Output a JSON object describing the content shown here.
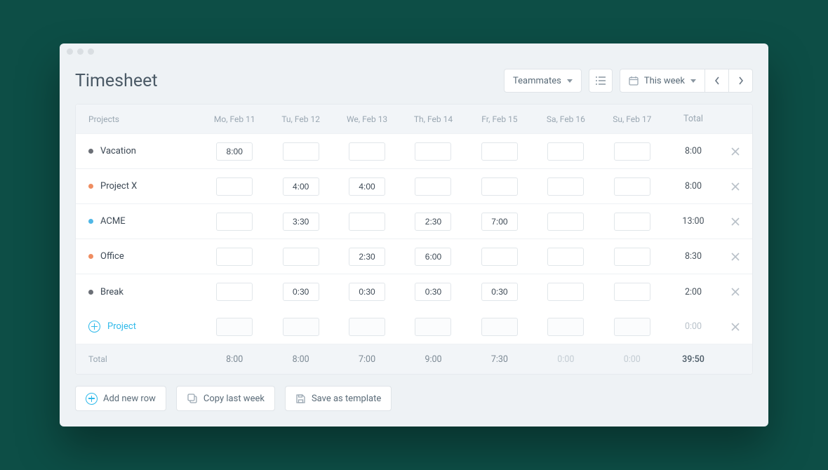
{
  "title": "Timesheet",
  "toolbar": {
    "teammates": "Teammates",
    "this_week": "This week"
  },
  "columns": {
    "projects": "Projects",
    "days": [
      "Mo, Feb 11",
      "Tu, Feb 12",
      "We, Feb 13",
      "Th, Feb 14",
      "Fr, Feb 15",
      "Sa, Feb 16",
      "Su, Feb 17"
    ],
    "total": "Total"
  },
  "rows": [
    {
      "name": "Vacation",
      "color": "#6b6f76",
      "cells": [
        "8:00",
        "",
        "",
        "",
        "",
        "",
        ""
      ],
      "total": "8:00"
    },
    {
      "name": "Project X",
      "color": "#ef8d61",
      "cells": [
        "",
        "4:00",
        "4:00",
        "",
        "",
        "",
        ""
      ],
      "total": "8:00"
    },
    {
      "name": "ACME",
      "color": "#4fb7e6",
      "cells": [
        "",
        "3:30",
        "",
        "2:30",
        "7:00",
        "",
        ""
      ],
      "total": "13:00"
    },
    {
      "name": "Office",
      "color": "#ef8d61",
      "cells": [
        "",
        "",
        "2:30",
        "6:00",
        "",
        "",
        ""
      ],
      "total": "8:30"
    },
    {
      "name": "Break",
      "color": "#6b6f76",
      "cells": [
        "",
        "0:30",
        "0:30",
        "0:30",
        "0:30",
        "",
        ""
      ],
      "total": "2:00"
    }
  ],
  "add_row": {
    "label": "Project",
    "total": "0:00"
  },
  "footer": {
    "label": "Total",
    "days": [
      "8:00",
      "8:00",
      "7:00",
      "9:00",
      "7:30",
      "0:00",
      "0:00"
    ],
    "grand_total": "39:50"
  },
  "actions": {
    "add_row": "Add new row",
    "copy_last_week": "Copy last week",
    "save_template": "Save as template"
  }
}
